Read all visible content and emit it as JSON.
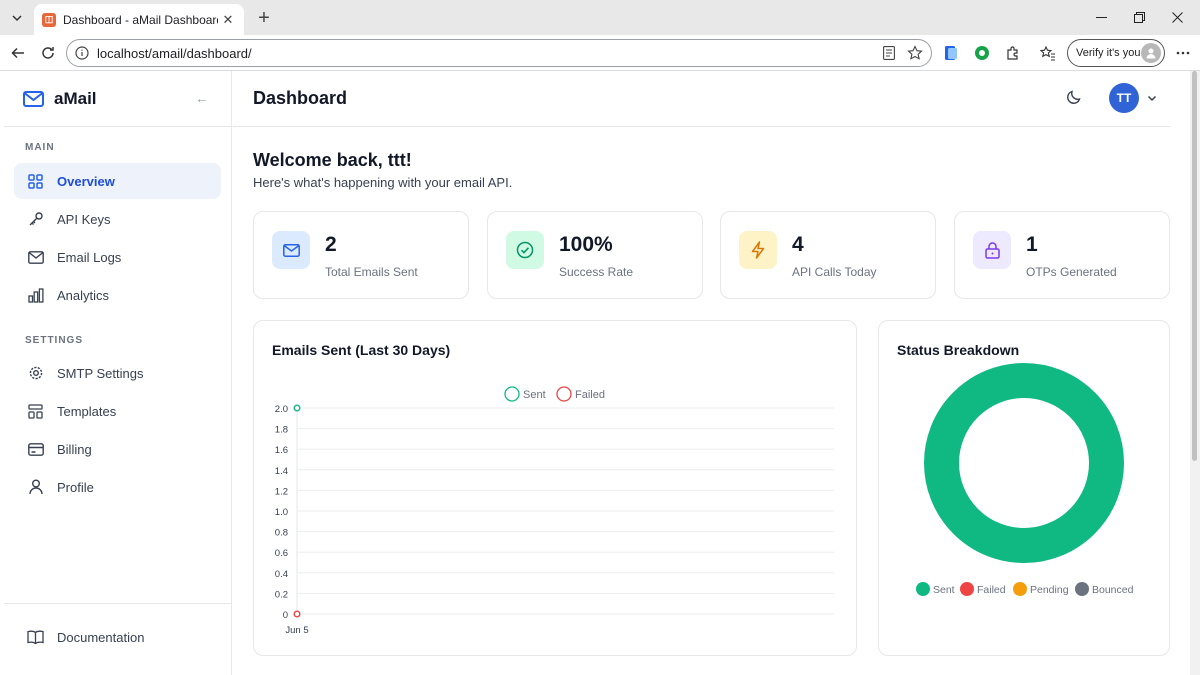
{
  "browser": {
    "tab_title": "Dashboard - aMail Dashboard",
    "url": "localhost/amail/dashboard/",
    "verify_label": "Verify it's you"
  },
  "sidebar": {
    "brand": "aMail",
    "main_label": "MAIN",
    "settings_label": "SETTINGS",
    "main_items": [
      {
        "label": "Overview",
        "icon": "grid-icon",
        "active": true
      },
      {
        "label": "API Keys",
        "icon": "key-icon"
      },
      {
        "label": "Email Logs",
        "icon": "mail-icon"
      },
      {
        "label": "Analytics",
        "icon": "bar-chart-icon"
      }
    ],
    "settings_items": [
      {
        "label": "SMTP Settings",
        "icon": "gear-icon"
      },
      {
        "label": "Templates",
        "icon": "template-icon"
      },
      {
        "label": "Billing",
        "icon": "credit-card-icon"
      },
      {
        "label": "Profile",
        "icon": "user-icon"
      }
    ],
    "footer_item": {
      "label": "Documentation",
      "icon": "book-icon"
    }
  },
  "header": {
    "title": "Dashboard",
    "avatar_initials": "TT"
  },
  "welcome": {
    "title": "Welcome back, ttt!",
    "subtitle": "Here's what's happening with your email API."
  },
  "stats": [
    {
      "value": "2",
      "label": "Total Emails Sent",
      "icon": "mail-icon",
      "bg": "#dbeafe",
      "color": "#2563eb"
    },
    {
      "value": "100%",
      "label": "Success Rate",
      "icon": "check-circle-icon",
      "bg": "#d1fae5",
      "color": "#059669"
    },
    {
      "value": "4",
      "label": "API Calls Today",
      "icon": "bolt-icon",
      "bg": "#fef3c7",
      "color": "#d97706"
    },
    {
      "value": "1",
      "label": "OTPs Generated",
      "icon": "lock-icon",
      "bg": "#ede9fe",
      "color": "#7c3aed"
    }
  ],
  "colors": {
    "accent": "#2563eb",
    "sent": "#10b981",
    "failed": "#ef4444",
    "pending": "#f59e0b",
    "bounced": "#6b7280"
  },
  "chart_data": [
    {
      "type": "line",
      "title": "Emails Sent (Last 30 Days)",
      "x": [
        "Jun 5"
      ],
      "series": [
        {
          "name": "Sent",
          "values": [
            2
          ]
        },
        {
          "name": "Failed",
          "values": [
            0
          ]
        }
      ],
      "ylim": [
        0,
        2
      ],
      "yticks": [
        "0",
        "0.2",
        "0.4",
        "0.6",
        "0.8",
        "1.0",
        "1.2",
        "1.4",
        "1.6",
        "1.8",
        "2.0"
      ],
      "legend": "top",
      "grid": true
    },
    {
      "type": "pie",
      "title": "Status Breakdown",
      "categories": [
        "Sent",
        "Failed",
        "Pending",
        "Bounced"
      ],
      "values": [
        2,
        0,
        0,
        0
      ],
      "legend": "bottom"
    }
  ]
}
